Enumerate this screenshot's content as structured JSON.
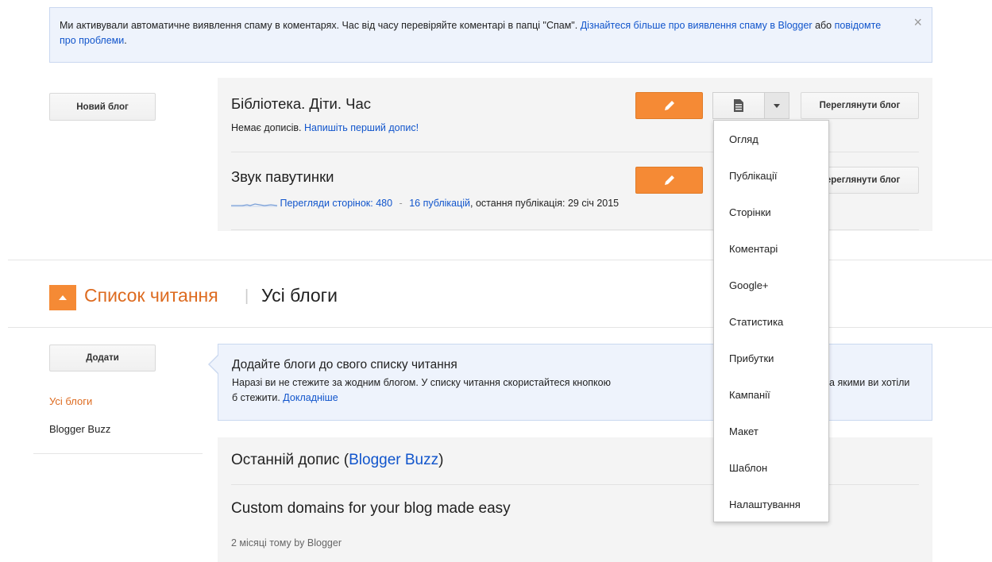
{
  "notice": {
    "text": "Ми активували автоматичне виявлення спаму в коментарях. Час від часу перевіряйте коментарі в папці \"Спам\".",
    "learn_more_link": "Дізнайтеся більше про виявлення спаму в Blogger",
    "or_text": "або",
    "report_link": "повідомте про проблеми",
    "end_text": ".",
    "close_icon": "×"
  },
  "sidebar": {
    "new_blog_button": "Новий блог"
  },
  "blogs": [
    {
      "title": "Бібліотека. Діти. Час",
      "no_posts_text": "Немає дописів.",
      "write_first_link": "Напишіть перший допис!",
      "view_button": "Переглянути блог"
    },
    {
      "title": "Звук павутинки",
      "pageviews_link": "Перегляди сторінок: 480",
      "sep": "-",
      "posts_link": "16 публікацій",
      "last_post_text": ", остання публікація: 29 січ 2015",
      "view_button": "Переглянути блог"
    }
  ],
  "menu": {
    "items": [
      "Огляд",
      "Публікації",
      "Сторінки",
      "Коментарі",
      "Google+",
      "Статистика",
      "Прибутки",
      "Кампанії",
      "Макет",
      "Шаблон",
      "Налаштування"
    ]
  },
  "reading_list": {
    "title": "Список читання",
    "separator": "|",
    "all_blogs_tab": "Усі блоги",
    "add_button": "Додати",
    "side_links": [
      "Усі блоги",
      "Blogger Buzz"
    ],
    "info_title": "Додайте блоги до свого списку читання",
    "info_text": "Наразі ви не стежите за жодним блогом. У списку читання скористайтеся кнопкою",
    "info_text_tail": "ати блоги, за якими ви хотіли б стежити.",
    "info_more_link": "Докладніше"
  },
  "last_post": {
    "heading_prefix": "Останній допис (",
    "heading_link": "Blogger Buzz",
    "heading_suffix": ")",
    "post_title": "Custom domains for your blog made easy",
    "meta": "2 місяці тому by Blogger"
  },
  "colors": {
    "accent_orange": "#f58a35",
    "link_blue": "#1155cc",
    "notice_bg": "#eef3fc"
  }
}
